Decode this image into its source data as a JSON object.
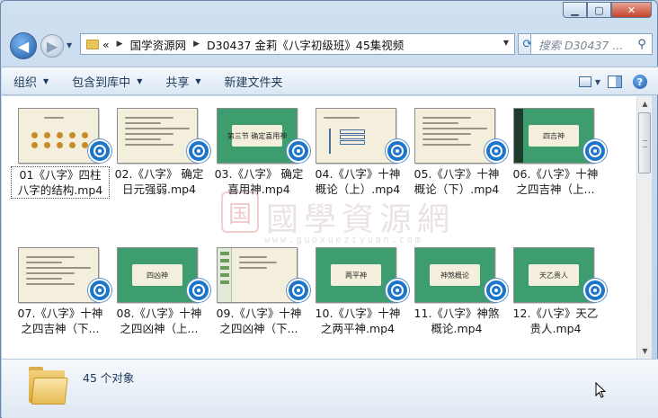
{
  "window": {
    "caption_buttons": [
      "minimize",
      "maximize",
      "close"
    ]
  },
  "nav": {
    "breadcrumb_lead": "«",
    "breadcrumbs": [
      "国学资源网",
      "D30437 金莉《八字初级班》45集视频"
    ],
    "search_placeholder": "搜索 D30437 ..."
  },
  "toolbar": {
    "organize": "组织",
    "include_library": "包含到库中",
    "share": "共享",
    "new_folder": "新建文件夹"
  },
  "watermark": {
    "seal": "国",
    "title": "國學資源網",
    "url": "www.guoxueziyuan.com"
  },
  "files": [
    {
      "line1": "01《八字》四柱",
      "line2": "八字的结构.mp4",
      "thumb": "chart",
      "title": "目录",
      "selected": true
    },
    {
      "line1": "02.《八字》 确定",
      "line2": "日元强弱.mp4",
      "thumb": "text",
      "title": "确定日元强弱的九种方法"
    },
    {
      "line1": "03.《八字》 确定",
      "line2": "喜用神.mp4",
      "thumb": "green",
      "title": "第三节 确定喜用神"
    },
    {
      "line1": "04.《八字》十神",
      "line2": "概论（上）.mp4",
      "thumb": "diagram",
      "title": "一、十神的含义"
    },
    {
      "line1": "05.《八字》十神",
      "line2": "概论（下）.mp4",
      "thumb": "text",
      "title": "四、十神性质的区分"
    },
    {
      "line1": "06.《八字》十神",
      "line2": "之四吉神（上...",
      "thumb": "green-side",
      "title": "四吉神"
    },
    {
      "line1": "07.《八字》十神",
      "line2": "之四吉神（下...",
      "thumb": "text",
      "title": "二、正官"
    },
    {
      "line1": "08.《八字》十神",
      "line2": "之四凶神（上...",
      "thumb": "green",
      "title": "四凶神"
    },
    {
      "line1": "09.《八字》十神",
      "line2": "之四凶神（下...",
      "thumb": "sidebar",
      "title": "二、七杀/偏官"
    },
    {
      "line1": "10.《八字》十神",
      "line2": "之两平神.mp4",
      "thumb": "green",
      "title": "两平神"
    },
    {
      "line1": "11.《八字》神煞",
      "line2": "概论.mp4",
      "thumb": "green",
      "title": "神煞概论"
    },
    {
      "line1": "12.《八字》天乙",
      "line2": "贵人.mp4",
      "thumb": "green",
      "title": "天乙贵人"
    }
  ],
  "details": {
    "count": "45 个对象"
  },
  "colors": {
    "accent": "#1d75c9",
    "thumb_green": "#3e9d6e",
    "thumb_cream": "#f4efdd"
  }
}
